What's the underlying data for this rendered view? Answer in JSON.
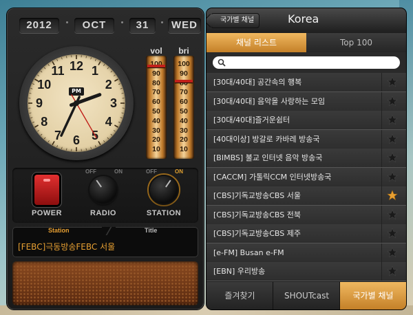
{
  "radio": {
    "date": {
      "year": "2012",
      "month": "OCT",
      "day": "31",
      "weekday": "WED"
    },
    "clock": {
      "am_pm": "PM",
      "numbers": [
        "12",
        "1",
        "2",
        "3",
        "4",
        "5",
        "6",
        "7",
        "8",
        "9",
        "10",
        "11"
      ],
      "hour_hand_angle_deg": 70,
      "minute_hand_angle_deg": 205,
      "second_hand_angle_deg": 150
    },
    "meters": {
      "vol_label": "vol",
      "bri_label": "bri",
      "ticks": [
        "100",
        "90",
        "80",
        "70",
        "60",
        "50",
        "40",
        "30",
        "20",
        "10"
      ],
      "vol_level_percent": 98,
      "bri_level_percent": 82
    },
    "controls": {
      "power_label": "POWER",
      "radio_label": "RADIO",
      "station_label": "STATION",
      "off_label": "OFF",
      "on_label": "ON"
    },
    "tuner": {
      "station_header": "Station",
      "title_header": "Title",
      "station_value": "[FEBC]극동방송FEBC 서울"
    },
    "colors": {
      "accent": "#e8a032",
      "power_red": "#d42424"
    }
  },
  "panel": {
    "back_label": "국가별 채널",
    "title": "Korea",
    "tabs": [
      {
        "label": "채널 리스트",
        "active": true
      },
      {
        "label": "Top 100",
        "active": false
      }
    ],
    "search": {
      "placeholder": ""
    },
    "channels": [
      {
        "name": "[30대/40대] 공간속의 행복",
        "favorite": false
      },
      {
        "name": "[30대/40대] 음악을 사랑하는 모임",
        "favorite": false
      },
      {
        "name": "[30대/40대]즐거운쉼터",
        "favorite": false
      },
      {
        "name": "[40대이상] 방갈로 카바레 방송국",
        "favorite": false
      },
      {
        "name": "[BIMBS] 불교 인터넷 음악 방송국",
        "favorite": false
      },
      {
        "name": "[CACCM] 가톨릭CCM 인터넷방송국",
        "favorite": false
      },
      {
        "name": "[CBS]기독교방송CBS 서울",
        "favorite": true
      },
      {
        "name": "[CBS]기독교방송CBS 전북",
        "favorite": false
      },
      {
        "name": "[CBS]기독교방송CBS 제주",
        "favorite": false
      },
      {
        "name": "[e-FM] Busan e-FM",
        "favorite": false
      },
      {
        "name": "[EBN] 우리방송",
        "favorite": false
      }
    ],
    "bottom_tabs": [
      {
        "label": "즐겨찾기",
        "active": false
      },
      {
        "label": "SHOUTcast",
        "active": false
      },
      {
        "label": "국가별 채널",
        "active": true
      }
    ]
  }
}
